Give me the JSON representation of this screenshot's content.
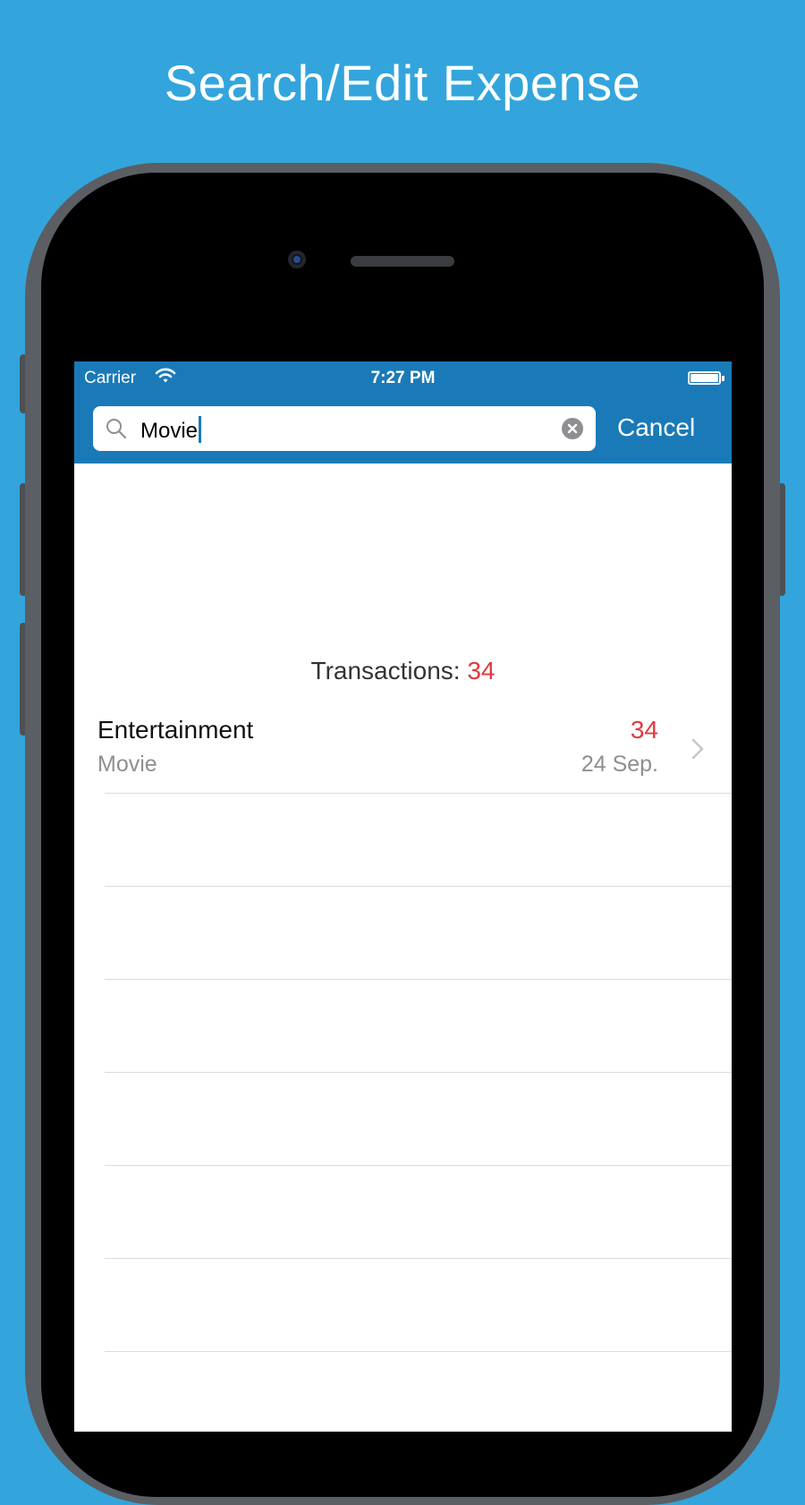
{
  "headline": "Search/Edit Expense",
  "status_bar": {
    "carrier": "Carrier",
    "time": "7:27 PM"
  },
  "search": {
    "query": "Movie",
    "cancel_label": "Cancel"
  },
  "summary": {
    "label": "Transactions:",
    "count": "34"
  },
  "transactions": [
    {
      "category": "Entertainment",
      "note": "Movie",
      "amount": "34",
      "date": "24 Sep."
    }
  ],
  "colors": {
    "background": "#33a5dc",
    "navbar": "#1a7ab8",
    "amount": "#e0393e"
  },
  "icons": [
    "wifi-icon",
    "battery-icon",
    "search-icon",
    "clear-icon",
    "chevron-right-icon"
  ]
}
